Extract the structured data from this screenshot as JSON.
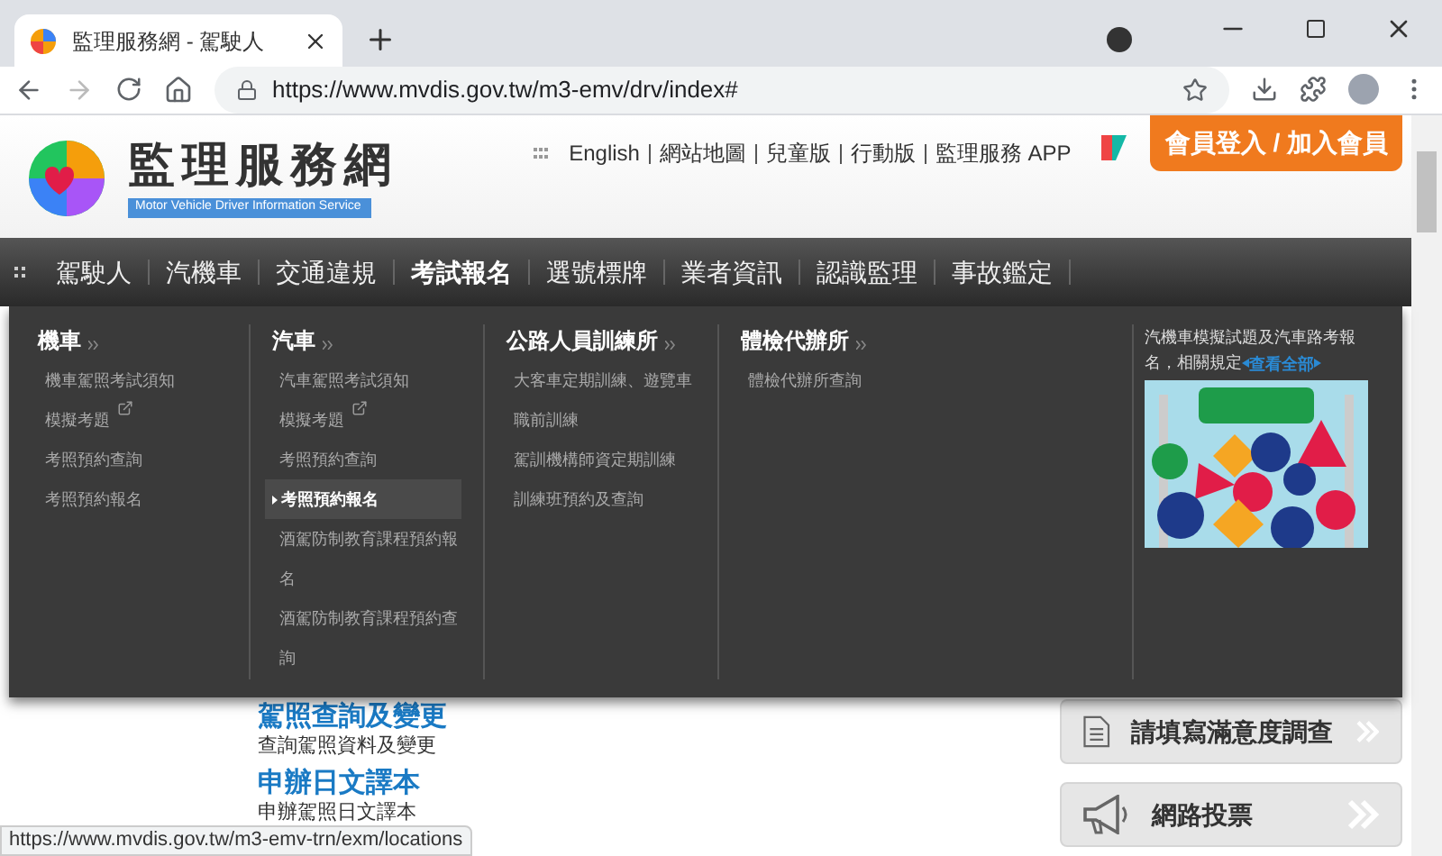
{
  "browser": {
    "tabs": [
      {
        "title": "監理服務網 - 駕駛人",
        "selected": true
      }
    ],
    "url": "https://www.mvdis.gov.tw/m3-emv/drv/index#"
  },
  "header": {
    "logo_title": "監理服務網",
    "logo_subtitle": "Motor Vehicle Driver Information Service",
    "top_links": [
      "English",
      "網站地圖",
      "兒童版",
      "行動版",
      "監理服務 APP"
    ],
    "login_button": "會員登入 / 加入會員"
  },
  "nav": {
    "items": [
      {
        "label": "駕駛人",
        "selected": false
      },
      {
        "label": "汽機車",
        "selected": false
      },
      {
        "label": "交通違規",
        "selected": false
      },
      {
        "label": "考試報名",
        "selected": true
      },
      {
        "label": "選號標牌",
        "selected": false
      },
      {
        "label": "業者資訊",
        "selected": false
      },
      {
        "label": "認識監理",
        "selected": false
      },
      {
        "label": "事故鑑定",
        "selected": false
      }
    ]
  },
  "menu": {
    "columns": [
      {
        "title": "機車",
        "links": [
          {
            "label": "機車駕照考試須知",
            "external": false,
            "selected": false
          },
          {
            "label": "模擬考題",
            "external": true,
            "selected": false
          },
          {
            "label": "考照預約查詢",
            "external": false,
            "selected": false
          },
          {
            "label": "考照預約報名",
            "external": false,
            "selected": false
          }
        ]
      },
      {
        "title": "汽車",
        "links": [
          {
            "label": "汽車駕照考試須知",
            "external": false,
            "selected": false
          },
          {
            "label": "模擬考題",
            "external": true,
            "selected": false
          },
          {
            "label": "考照預約查詢",
            "external": false,
            "selected": false
          },
          {
            "label": "考照預約報名",
            "external": false,
            "selected": true
          },
          {
            "label": "酒駕防制教育課程預約報名",
            "external": false,
            "selected": false
          },
          {
            "label": "酒駕防制教育課程預約查詢",
            "external": false,
            "selected": false
          }
        ]
      },
      {
        "title": "公路人員訓練所",
        "links": [
          {
            "label": "大客車定期訓練、遊覽車職前訓練",
            "external": false,
            "selected": false
          },
          {
            "label": "駕訓機構師資定期訓練",
            "external": false,
            "selected": false
          },
          {
            "label": "訓練班預約及查詢",
            "external": false,
            "selected": false
          }
        ]
      },
      {
        "title": "體檢代辦所",
        "links": [
          {
            "label": "體檢代辦所查詢",
            "external": false,
            "selected": false
          }
        ]
      }
    ],
    "promo": {
      "text": "汽機車模擬試題及汽車路考報名，相關規定",
      "link": "查看全部"
    }
  },
  "content": {
    "items": [
      {
        "title": "駕照查詢及變更",
        "desc": "查詢駕照資料及變更"
      },
      {
        "title": "申辦日文譯本",
        "desc": "申辦駕照日文譯本"
      }
    ],
    "side_buttons": [
      {
        "label": "請填寫滿意度調查",
        "kind": "survey"
      },
      {
        "label": "網路投票",
        "kind": "vote"
      }
    ]
  },
  "status_url": "https://www.mvdis.gov.tw/m3-emv-trn/exm/locations"
}
